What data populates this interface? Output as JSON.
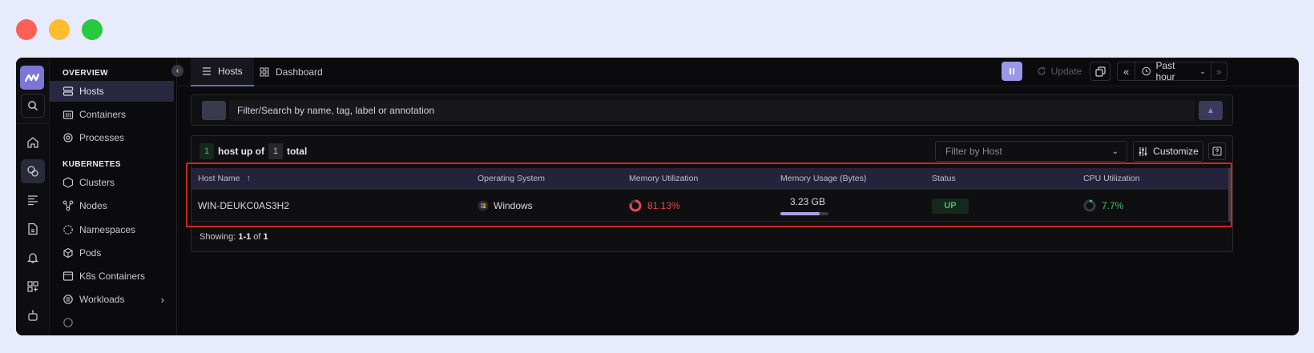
{
  "window_controls": [
    "close",
    "minimize",
    "maximize"
  ],
  "rail": {
    "icons": [
      "logo-icon",
      "search-icon",
      "home-icon",
      "infrastructure-icon",
      "logs-icon",
      "file-icon",
      "alert-icon",
      "dashboard-add-icon",
      "robot-icon"
    ]
  },
  "sidebar": {
    "overview_label": "OVERVIEW",
    "overview_items": [
      {
        "label": "Hosts",
        "icon": "server-icon",
        "active": true
      },
      {
        "label": "Containers",
        "icon": "container-icon"
      },
      {
        "label": "Processes",
        "icon": "process-icon"
      }
    ],
    "kubernetes_label": "KUBERNETES",
    "kubernetes_items": [
      {
        "label": "Clusters",
        "icon": "cluster-icon"
      },
      {
        "label": "Nodes",
        "icon": "nodes-icon"
      },
      {
        "label": "Namespaces",
        "icon": "namespace-icon"
      },
      {
        "label": "Pods",
        "icon": "pod-icon"
      },
      {
        "label": "K8s Containers",
        "icon": "k8s-container-icon"
      },
      {
        "label": "Workloads",
        "icon": "workload-icon",
        "has_submenu": true
      }
    ]
  },
  "topbar": {
    "tabs": [
      {
        "label": "Hosts",
        "icon": "list-icon",
        "active": true
      },
      {
        "label": "Dashboard",
        "icon": "grid-icon"
      }
    ],
    "update_label": "Update",
    "time_range": "Past hour"
  },
  "filter": {
    "placeholder": "Filter/Search by name, tag, label or annotation"
  },
  "summary": {
    "up_count": "1",
    "up_text": "host up of",
    "total_count": "1",
    "total_text": "total"
  },
  "host_filter": {
    "placeholder": "Filter by Host"
  },
  "customize_label": "Customize",
  "table": {
    "columns": [
      "Host Name",
      "Operating System",
      "Memory Utilization",
      "Memory Usage (Bytes)",
      "Status",
      "CPU Utilization"
    ],
    "sort_indicator": "↑",
    "rows": [
      {
        "host_name": "WIN-DEUKC0AS3H2",
        "os": "Windows",
        "memory_utilization": "81.13%",
        "memory_utilization_value": 0.8113,
        "memory_usage": "3.23 GB",
        "memory_usage_fraction": 0.8113,
        "status": "UP",
        "cpu_utilization": "7.7%",
        "cpu_utilization_value": 0.077
      }
    ]
  },
  "pagination": {
    "prefix": "Showing:",
    "range": "1-1",
    "of": "of",
    "total": "1"
  },
  "colors": {
    "accent": "#9c97e8",
    "danger": "#e5484d",
    "success": "#3fbf62",
    "highlight": "#d0281c"
  }
}
